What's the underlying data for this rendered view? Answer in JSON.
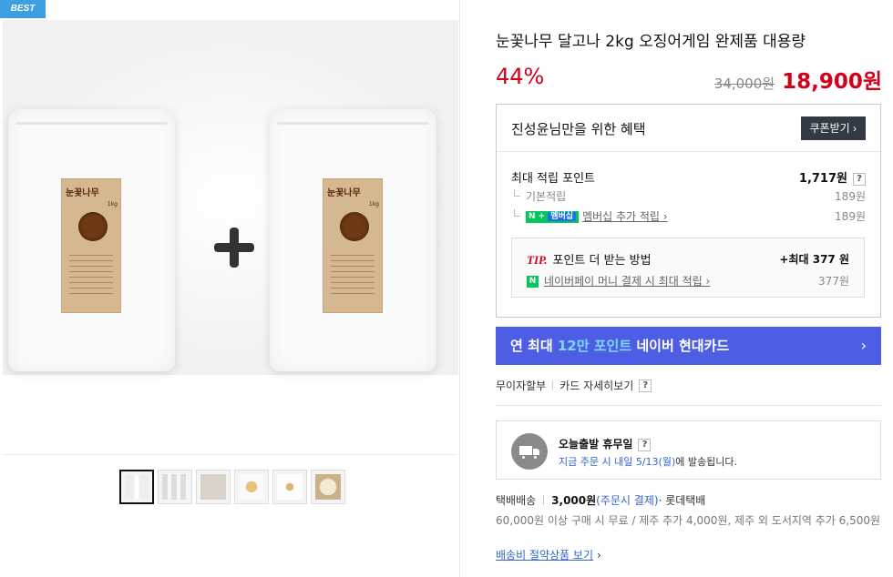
{
  "badge": "BEST",
  "product": {
    "title": "눈꽃나무 달고나 2kg 오징어게임 완제품 대용량",
    "discount": "44%",
    "original_price": "34,000원",
    "sale_price": "18,900원"
  },
  "images": {
    "bag_brand": "눈꽃나무",
    "bag_weight": "1kg",
    "thumbnail_count": 6
  },
  "benefits": {
    "title": "진성윤님만을 위한 혜택",
    "coupon_button": "쿠폰받기 ›",
    "max_points_label": "최대 적립 포인트",
    "max_points_value": "1,717원",
    "help": "?",
    "basic_label": "기본적립",
    "basic_value": "189원",
    "nplus_badge": "N +",
    "nplus_sub": "멤버십",
    "membership_label": "멤버십 추가 적립 ›",
    "membership_value": "189원",
    "tip": {
      "label": "TIP.",
      "text": "포인트 더 받는 방법",
      "value": "+최대 377 원",
      "npay_icon": "N",
      "npay_text": "네이버페이 머니 결제 시 최대 적립 ›",
      "npay_value": "377원"
    }
  },
  "card_banner": {
    "prefix": "연 최대 ",
    "highlight": "12만 포인트",
    "suffix": " 네이버 현대카드",
    "chevron": "›"
  },
  "installment": {
    "label": "무이자할부",
    "card_detail": "카드 자세히보기",
    "help": "?"
  },
  "shipping": {
    "title": "오늘출발 휴무일",
    "help": "?",
    "desc_blue": "지금 주문 시 내일 5/13(월)",
    "desc_rest": "에 발송됩니다."
  },
  "delivery": {
    "type": "택배배송",
    "fee": "3,000원",
    "condition": "(주문시 결제)",
    "courier": " · 롯데택배",
    "extra": "60,000원 이상 구매 시 무료 / 제주 추가 4,000원, 제주 외 도서지역 추가 6,500원",
    "save_link": "배송비 절약상품 보기",
    "save_chev": "›"
  },
  "colors": {
    "accent_red": "#d0021b",
    "banner_blue": "#4e5ee4",
    "naver_green": "#03c75a",
    "link_blue": "#3366cc"
  }
}
